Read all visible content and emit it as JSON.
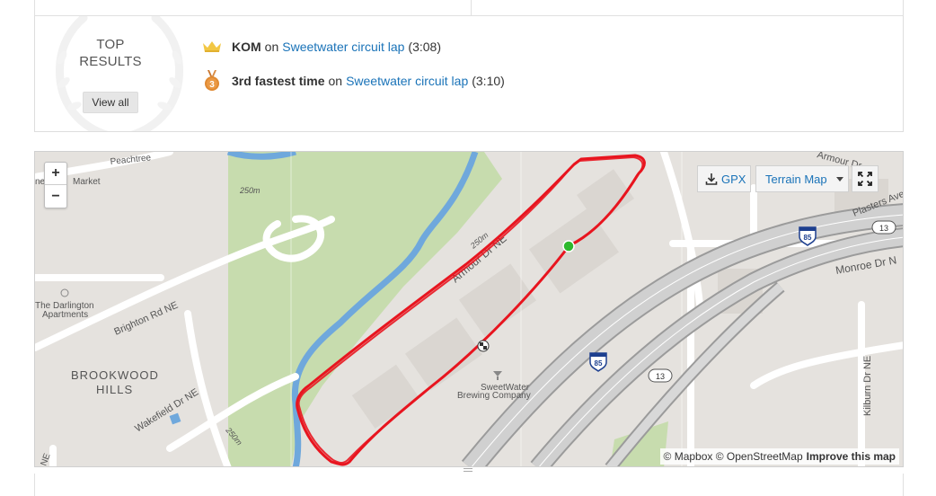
{
  "results": {
    "heading_line1": "TOP",
    "heading_line2": "RESULTS",
    "view_all_label": "View all",
    "achievements": [
      {
        "icon": "crown-icon",
        "title": "KOM",
        "connector": "on",
        "segment": "Sweetwater circuit lap",
        "time": "(3:08)"
      },
      {
        "icon": "bronze-medal-icon",
        "medal_number": "3",
        "title": "3rd fastest time",
        "connector": "on",
        "segment": "Sweetwater circuit lap",
        "time": "(3:10)"
      }
    ]
  },
  "map": {
    "zoom_in_label": "+",
    "zoom_out_label": "−",
    "gpx_label": "GPX",
    "terrain_label": "Terrain Map",
    "attribution_mapbox": "© Mapbox",
    "attribution_osm": "© OpenStreetMap",
    "attribution_improve": "Improve this map",
    "labels": {
      "peachtree": "Peachtree",
      "market": "Market",
      "ne": "ne",
      "contour_250_top": "250m",
      "darlington": "The Darlington",
      "apartments": "Apartments",
      "brighton": "Brighton Rd NE",
      "brookwood": "BROOKWOOD",
      "hills": "HILLS",
      "wakefield": "Wakefield Dr NE",
      "contour_250_bottom": "250m",
      "ne_bottom": "NE",
      "armour_dr": "Armour Dr NE",
      "contour_250_mid": "250m",
      "sweetwater1": "SweetWater",
      "sweetwater2": "Brewing Company",
      "armour_top": "Armour Dr",
      "plasters": "Plasters Ave",
      "monroe": "Monroe Dr N",
      "kilburn": "Kilburn Dr NE",
      "shield_85_top": "85",
      "shield_13_top": "13",
      "shield_85_mid": "85",
      "shield_13_mid": "13"
    },
    "colors": {
      "route": "#e8151f",
      "start": "#2db92d",
      "park": "#c7dcae",
      "water": "#6fa8dc",
      "highway": "#9b9b9b",
      "accent": "#1a73b8"
    }
  }
}
